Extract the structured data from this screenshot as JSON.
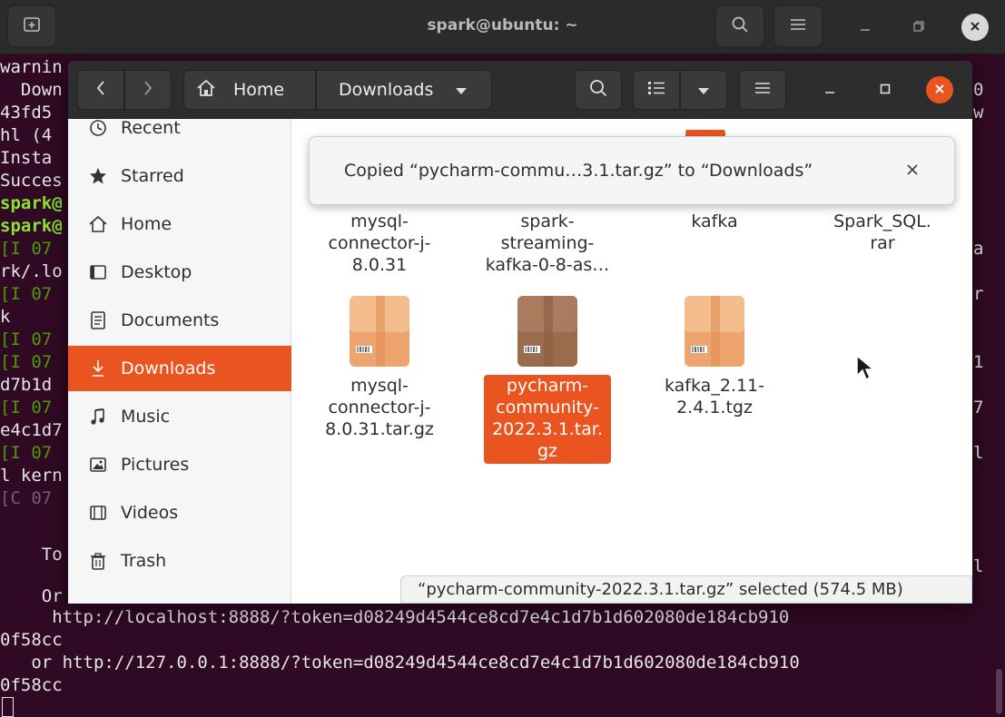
{
  "terminal": {
    "title": "spark@ubuntu: ~",
    "lines_left": [
      {
        "text": "warnin",
        "cls": ""
      },
      {
        "text": "  Down",
        "cls": ""
      },
      {
        "text": "43fd5",
        "cls": ""
      },
      {
        "text": "hl (4",
        "cls": ""
      },
      {
        "text": "Insta",
        "cls": ""
      },
      {
        "text": "Succes",
        "cls": ""
      },
      {
        "text": "spark@",
        "cls": "gb"
      },
      {
        "text": "spark@",
        "cls": "gb"
      },
      {
        "text": "[I 07",
        "cls": "g"
      },
      {
        "text": "rk/.lo",
        "cls": ""
      },
      {
        "text": "[I 07",
        "cls": "g"
      },
      {
        "text": "k",
        "cls": ""
      },
      {
        "text": "[I 07",
        "cls": "g"
      },
      {
        "text": "[I 07",
        "cls": "g"
      },
      {
        "text": "d7b1d",
        "cls": ""
      },
      {
        "text": "[I 07",
        "cls": "g"
      },
      {
        "text": "e4c1d7",
        "cls": ""
      },
      {
        "text": "[I 07",
        "cls": "g"
      },
      {
        "text": "l kern",
        "cls": ""
      },
      {
        "text": "[C 07",
        "cls": "dim"
      }
    ],
    "lines_right": [
      {
        "text": "0",
        "row": 1
      },
      {
        "text": "w",
        "row": 2
      },
      {
        "text": "a",
        "row": 8
      },
      {
        "text": "r",
        "row": 10
      },
      {
        "text": "1",
        "row": 13
      },
      {
        "text": "7",
        "row": 15
      },
      {
        "text": "l",
        "row": 17
      },
      {
        "text": "l",
        "row": 22
      }
    ],
    "to_text": "    To",
    "or_text": "    Or",
    "bottom_lines": [
      "     http://localhost:8888/?token=d08249d4544ce8cd7e4c1d7b1d602080de184cb910",
      "0f58cc",
      "   or http://127.0.0.1:8888/?token=d08249d4544ce8cd7e4c1d7b1d602080de184cb910",
      "0f58cc"
    ]
  },
  "files": {
    "breadcrumb": {
      "home": "Home",
      "current": "Downloads"
    },
    "sidebar": [
      {
        "label": "Recent",
        "icon": "clock-icon"
      },
      {
        "label": "Starred",
        "icon": "star-icon"
      },
      {
        "label": "Home",
        "icon": "home-icon"
      },
      {
        "label": "Desktop",
        "icon": "desktop-icon"
      },
      {
        "label": "Documents",
        "icon": "document-icon"
      },
      {
        "label": "Downloads",
        "icon": "download-icon",
        "active": true
      },
      {
        "label": "Music",
        "icon": "music-icon"
      },
      {
        "label": "Pictures",
        "icon": "picture-icon"
      },
      {
        "label": "Videos",
        "icon": "video-icon"
      },
      {
        "label": "Trash",
        "icon": "trash-icon"
      }
    ],
    "row1": [
      {
        "name": "mysql-\nconnector-j-\n8.0.31"
      },
      {
        "name": "spark-\nstreaming-\nkafka-0-8-as…"
      },
      {
        "name": "kafka"
      },
      {
        "name": "Spark_SQL.\nrar"
      }
    ],
    "row2": [
      {
        "name": "mysql-\nconnector-j-\n8.0.31.tar.gz",
        "selected": false
      },
      {
        "name": "pycharm-\ncommunity-\n2022.3.1.tar.\ngz",
        "selected": true
      },
      {
        "name": "kafka_2.11-\n2.4.1.tgz",
        "selected": false
      }
    ],
    "toast": "Copied “pycharm-commu…3.1.tar.gz” to “Downloads”",
    "status": "“pycharm-community-2022.3.1.tar.gz” selected  (574.5 MB)"
  },
  "colors": {
    "accent": "#e95420",
    "terminal_bg": "#300a24"
  }
}
